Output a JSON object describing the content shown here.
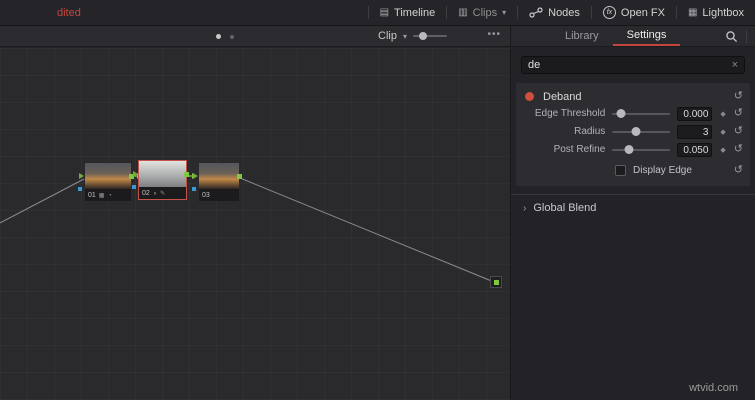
{
  "top_bar": {
    "project_label": "dited",
    "items": [
      {
        "label": "Timeline"
      },
      {
        "label": "Clips"
      },
      {
        "label": "Nodes"
      },
      {
        "label": "Open FX"
      },
      {
        "label": "Lightbox"
      }
    ],
    "fx_badge": "fx",
    "clips_chevron": "▾"
  },
  "node_editor": {
    "clip_selector_label": "Clip",
    "clip_chevron": "▾",
    "menu_dots": "•••"
  },
  "panel": {
    "tabs": [
      {
        "label": "Library"
      },
      {
        "label": "Settings"
      }
    ],
    "search_value": "de",
    "clear_glyph": "×",
    "effect": {
      "title": "Deband",
      "params": [
        {
          "label": "Edge Threshold",
          "value": "0.000",
          "pos": 0.15
        },
        {
          "label": "Radius",
          "value": "3",
          "pos": 0.42
        },
        {
          "label": "Post Refine",
          "value": "0.050",
          "pos": 0.3
        }
      ],
      "display_edge_label": "Display Edge"
    },
    "global_blend_label": "Global Blend",
    "global_blend_chevron": "›",
    "reset_glyph": "↺",
    "keyframe_glyph": "◆"
  },
  "nodes": [
    {
      "id": "01",
      "icons": "▦ ◔"
    },
    {
      "id": "02",
      "icons": "◑ ✎"
    },
    {
      "id": "03",
      "icons": ""
    }
  ],
  "watermark": "wtvid.com"
}
